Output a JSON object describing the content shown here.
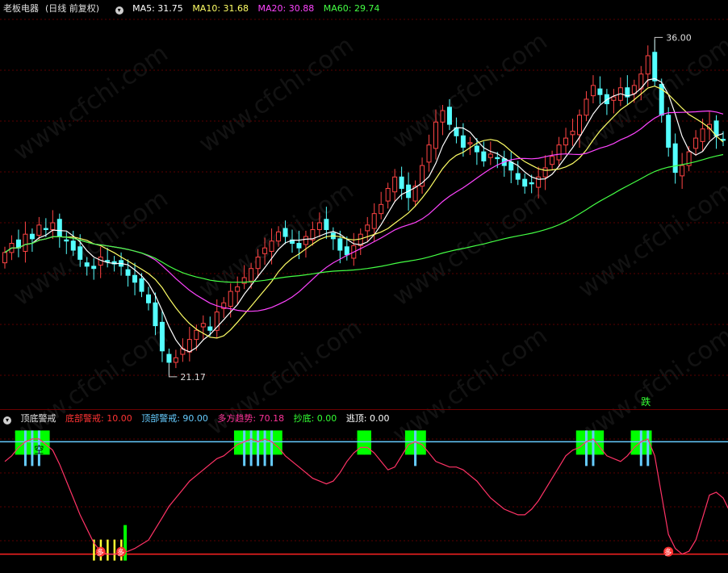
{
  "main_panel": {
    "title": "老板电器",
    "adjust": "(日线 前复权)",
    "ma_labels": [
      {
        "text": "MA5: 31.75",
        "color": "#ffffff"
      },
      {
        "text": "MA10: 31.68",
        "color": "#ffff66"
      },
      {
        "text": "MA20: 30.88",
        "color": "#ff44ff"
      },
      {
        "text": "MA60: 29.74",
        "color": "#44ff44"
      }
    ],
    "high_label": "36.00",
    "low_label": "21.17",
    "drop_marker": "跌"
  },
  "sub_panel": {
    "title": "顶底警戒",
    "labels": [
      {
        "text": "底部警戒: 10.00",
        "color": "#ff3333"
      },
      {
        "text": "顶部警戒: 90.00",
        "color": "#66ccff"
      },
      {
        "text": "多方趋势: 70.18",
        "color": "#ff3399"
      },
      {
        "text": "抄底: 0.00",
        "color": "#33ff33"
      },
      {
        "text": "逃顶: 0.00",
        "color": "#ffffff"
      }
    ],
    "kong_marker": "空",
    "duo_marker": "多"
  },
  "watermark": "www.cfchi.com",
  "colors": {
    "up": "#ff4444",
    "down": "#54ffff",
    "ma5": "#ffffff",
    "ma10": "#ffff66",
    "ma20": "#ff44ff",
    "ma60": "#44ff44",
    "trend": "#ff3366",
    "top_line": "#66ccff",
    "bottom_line": "#ff2222",
    "alert": "#00ff00"
  },
  "chart_data": [
    {
      "type": "candlestick",
      "title": "老板电器 (日线 前复权)",
      "ylim": [
        20.0,
        37.0
      ],
      "annotations": [
        {
          "label": "36.00",
          "value": 36.0
        },
        {
          "label": "21.17",
          "value": 21.17
        }
      ],
      "ma_last": {
        "MA5": 31.75,
        "MA10": 31.68,
        "MA20": 30.88,
        "MA60": 29.74
      },
      "close": [
        26.6,
        27.0,
        26.8,
        27.4,
        27.2,
        27.8,
        27.6,
        27.9,
        27.3,
        27.1,
        26.7,
        26.3,
        26.0,
        25.9,
        26.4,
        26.2,
        26.1,
        26.0,
        25.6,
        25.3,
        24.9,
        24.4,
        23.4,
        22.3,
        21.8,
        22.0,
        22.4,
        22.8,
        23.2,
        23.5,
        23.2,
        24.0,
        24.4,
        24.9,
        25.1,
        25.5,
        25.9,
        26.4,
        26.8,
        27.1,
        27.5,
        27.3,
        27.0,
        26.8,
        27.3,
        27.6,
        27.9,
        27.6,
        27.2,
        26.7,
        26.5,
        26.9,
        27.4,
        27.8,
        28.3,
        28.7,
        29.4,
        29.9,
        29.4,
        29.0,
        29.5,
        30.4,
        31.3,
        32.3,
        32.8,
        32.2,
        31.7,
        31.2,
        31.4,
        31.0,
        30.6,
        30.9,
        30.7,
        30.4,
        30.2,
        29.8,
        29.5,
        29.6,
        29.9,
        30.3,
        30.8,
        31.3,
        31.6,
        31.9,
        32.6,
        33.3,
        33.9,
        33.5,
        33.1,
        33.4,
        33.8,
        33.4,
        33.9,
        34.4,
        35.2,
        34.1,
        32.6,
        31.2,
        30.1,
        30.4,
        31.0,
        31.6,
        32.0,
        32.2,
        31.7,
        31.5
      ]
    },
    {
      "type": "line",
      "title": "顶底警戒",
      "ylim": [
        0,
        100
      ],
      "series": [
        {
          "name": "底部警戒",
          "values": "constant 10.00"
        },
        {
          "name": "顶部警戒",
          "values": "constant 90.00"
        },
        {
          "name": "多方趋势",
          "values": [
            76,
            80,
            86,
            90,
            92,
            92,
            88,
            84,
            74,
            62,
            50,
            38,
            28,
            18,
            12,
            10,
            10,
            11,
            12,
            14,
            17,
            20,
            28,
            36,
            44,
            50,
            56,
            62,
            66,
            70,
            74,
            78,
            80,
            84,
            88,
            90,
            92,
            90,
            92,
            90,
            86,
            80,
            76,
            72,
            68,
            64,
            62,
            60,
            62,
            68,
            76,
            82,
            86,
            86,
            82,
            76,
            70,
            72,
            80,
            88,
            90,
            88,
            82,
            76,
            74,
            72,
            72,
            70,
            66,
            62,
            56,
            50,
            46,
            42,
            40,
            38,
            38,
            42,
            48,
            56,
            64,
            72,
            80,
            84,
            86,
            90,
            92,
            86,
            80,
            78,
            76,
            80,
            86,
            90,
            92,
            80,
            52,
            24,
            14,
            10,
            12,
            20,
            36,
            52,
            54,
            50,
            40,
            36
          ]
        }
      ]
    }
  ]
}
